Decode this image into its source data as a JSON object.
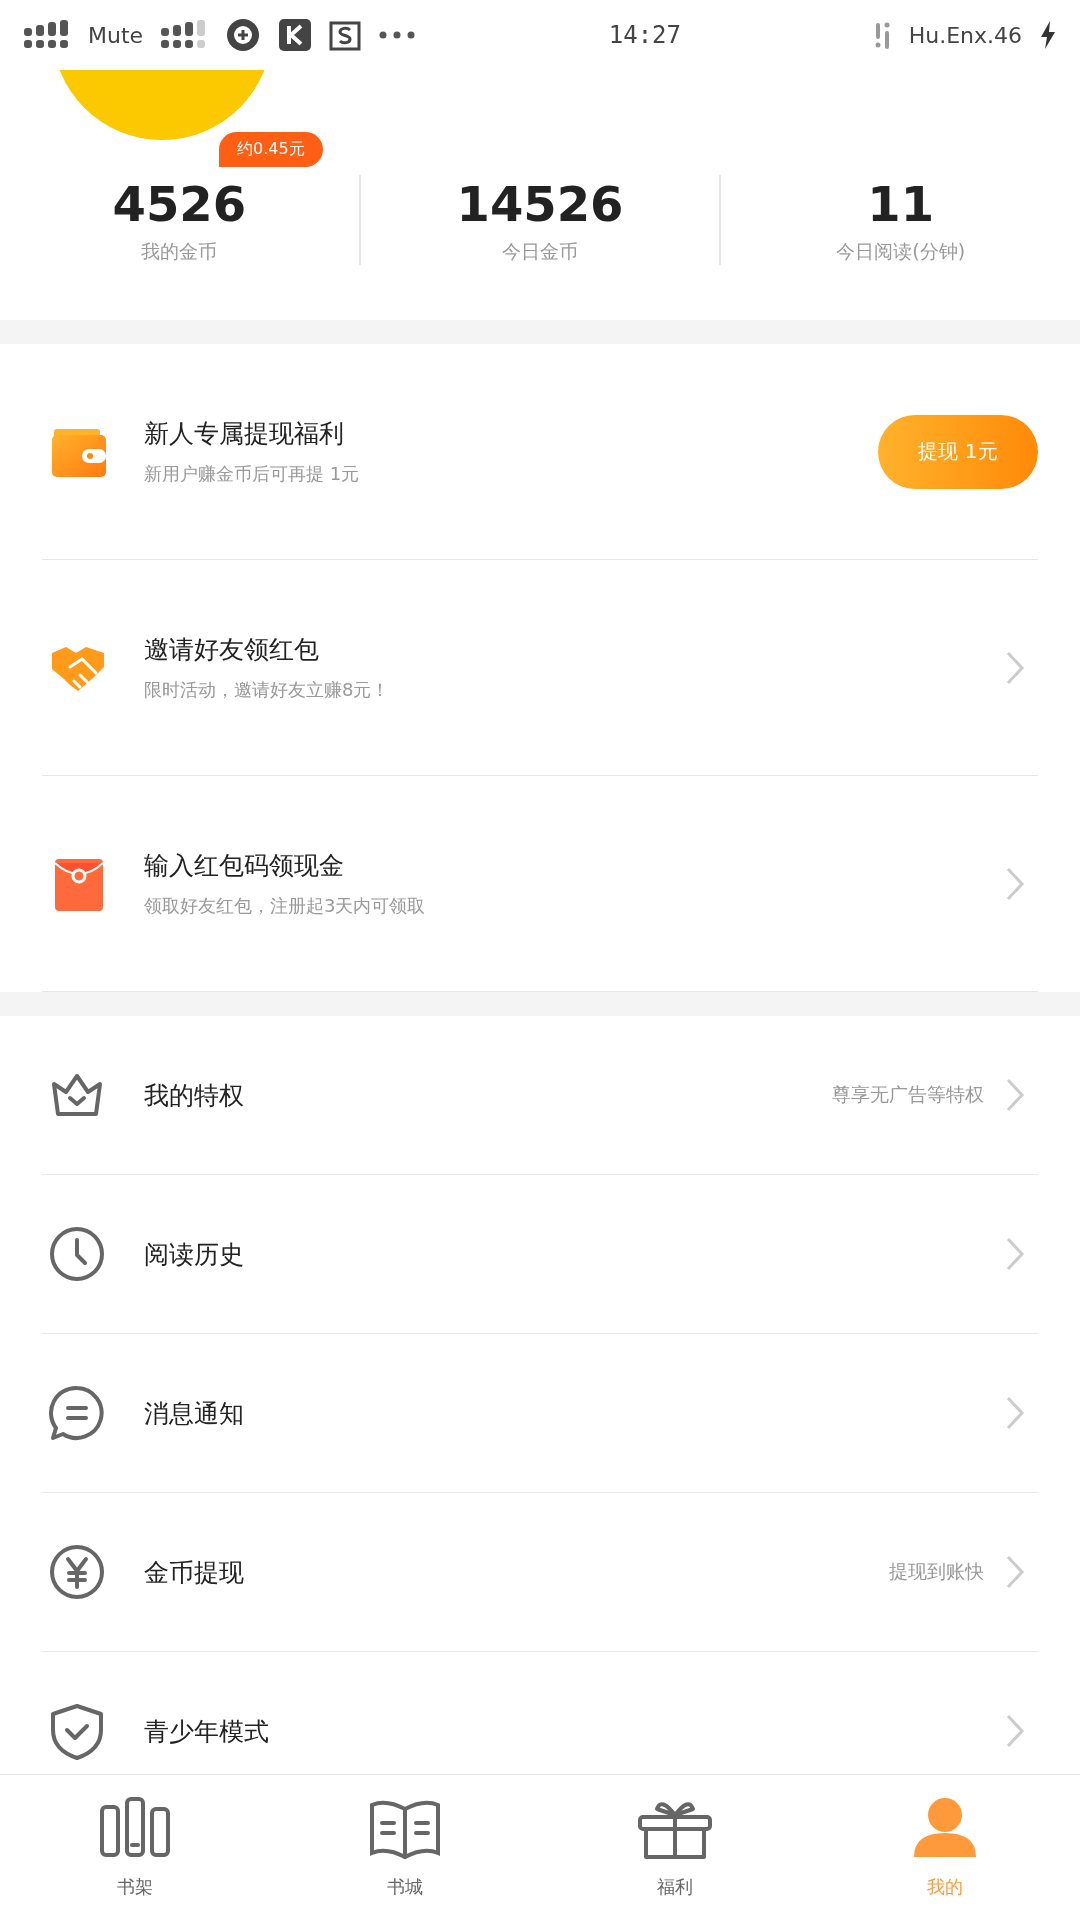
{
  "status_bar": {
    "mute": "Mute",
    "time": "14:27",
    "carrier": "Hu.Enx.46"
  },
  "profile": {
    "badge": "约0.45元"
  },
  "stats": [
    {
      "value": "4526",
      "label": "我的金币"
    },
    {
      "value": "14526",
      "label": "今日金币"
    },
    {
      "value": "11",
      "label": "今日阅读(分钟)"
    }
  ],
  "promos": [
    {
      "kind": "button",
      "title": "新人专属提现福利",
      "subtitle": "新用户赚金币后可再提 1元",
      "button": "提现 1元"
    },
    {
      "kind": "arrow",
      "title": "邀请好友领红包",
      "subtitle": "限时活动，邀请好友立赚8元！"
    },
    {
      "kind": "arrow",
      "title": "输入红包码领现金",
      "subtitle": "领取好友红包，注册起3天内可领取"
    }
  ],
  "menu": [
    {
      "title": "我的特权",
      "note": "尊享无广告等特权"
    },
    {
      "title": "阅读历史"
    },
    {
      "title": "消息通知"
    },
    {
      "title": "金币提现",
      "note": "提现到账快"
    },
    {
      "title": "青少年模式"
    }
  ],
  "tabs": [
    {
      "label": "书架",
      "selected": false
    },
    {
      "label": "书城",
      "selected": false
    },
    {
      "label": "福利",
      "selected": false
    },
    {
      "label": "我的",
      "selected": true
    }
  ]
}
